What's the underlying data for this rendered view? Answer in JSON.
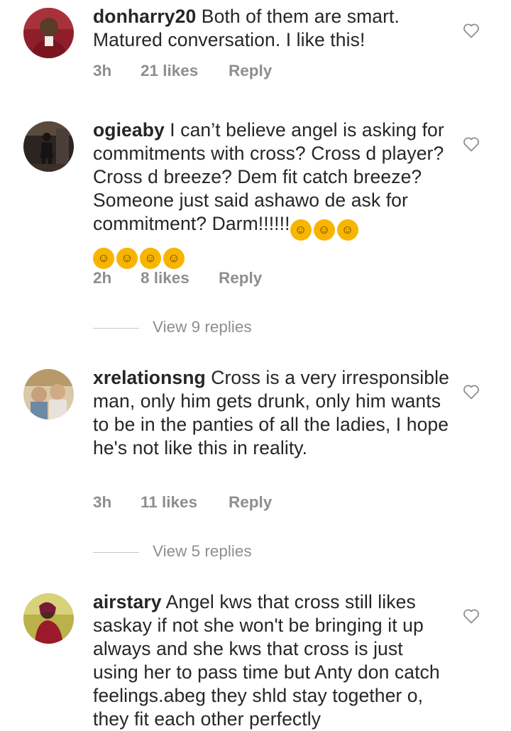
{
  "comments": [
    {
      "username": "donharry20",
      "text": " Both of them are smart. Matured conversation. I like this!",
      "time": "3h",
      "likes": "21 likes",
      "reply": "Reply"
    },
    {
      "username": "ogieaby",
      "text": " I can’t believe angel is asking for commitments with cross? Cross d player? Cross d breeze? Dem fit catch breeze? Someone just said ashawo de ask for commitment?  Darm!!!!!!",
      "text_after": "",
      "emoji_line1": [
        "rofl-emoji",
        "rofl-emoji",
        "rofl-emoji"
      ],
      "emoji_line2": [
        "rofl-emoji",
        "rofl-emoji",
        "rofl-emoji",
        "rofl-emoji"
      ],
      "time": "2h",
      "likes": "8 likes",
      "reply": "Reply",
      "view_replies": "View 9 replies"
    },
    {
      "username": "xrelationsng",
      "text": " Cross is a very irresponsible man, only him gets drunk, only him wants to be in the panties of all the ladies, I hope he's not like this in reality.",
      "time": "3h",
      "likes": "11 likes",
      "reply": "Reply",
      "view_replies": "View 5 replies"
    },
    {
      "username": "airstary",
      "text": " Angel kws that cross still likes saskay if not she won't be bringing it up always and she kws that cross is just using her to pass time  but Anty don catch feelings.abeg they shld stay together o, they fit each other perfectly"
    }
  ],
  "icons": {
    "like": "heart-outline-icon",
    "emoji": "rolling-on-floor-laughing-emoji"
  },
  "colors": {
    "text": "#262626",
    "meta": "#8e8e8e",
    "emoji": "#f7b500"
  }
}
